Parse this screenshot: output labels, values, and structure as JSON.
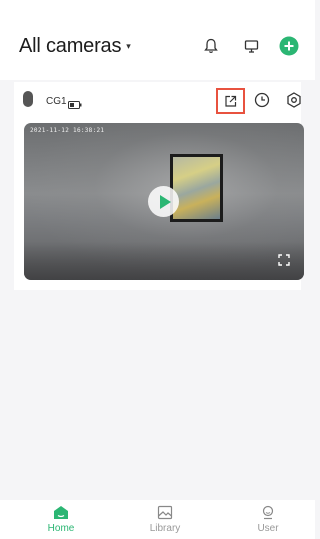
{
  "header": {
    "title": "All cameras",
    "caret": "▾"
  },
  "camera": {
    "name": "CG1",
    "timestamp": "2021-11-12 16:38:21"
  },
  "tabs": [
    {
      "label": "Home",
      "icon": "home-icon",
      "active": true
    },
    {
      "label": "Library",
      "icon": "image-icon",
      "active": false
    },
    {
      "label": "User",
      "icon": "user-icon",
      "active": false
    }
  ],
  "colors": {
    "accent": "#2bb673",
    "highlight_box": "#e8523f"
  }
}
